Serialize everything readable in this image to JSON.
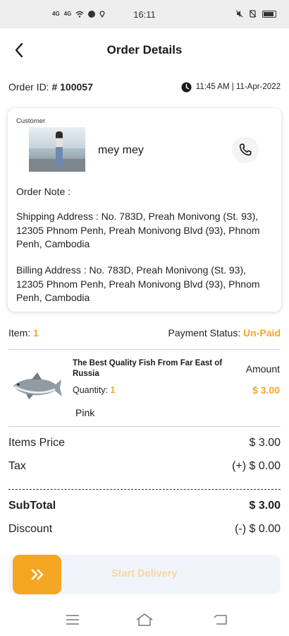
{
  "status_bar": {
    "time": "16:11",
    "signal_1": "4G",
    "signal_2": "4G"
  },
  "header": {
    "title": "Order Details",
    "back_icon": "chevron-left-icon"
  },
  "order": {
    "id_label": "Order ID: ",
    "id_value": "# 100057",
    "time": "11:45 AM | 11-Apr-2022",
    "clock_icon": "clock-icon"
  },
  "customer": {
    "label": "Customer",
    "name": "mey mey",
    "call_icon": "phone-icon",
    "order_note": "Order Note :",
    "shipping_address": "Shipping Address : No. 783D, Preah Monivong (St. 93), 12305 Phnom Penh, Preah Monivong Blvd (93), Phnom Penh, Cambodia",
    "billing_address": "Billing Address : No. 783D, Preah Monivong (St. 93), 12305 Phnom Penh, Preah Monivong Blvd (93), Phnom Penh, Cambodia"
  },
  "summary": {
    "item_label": "Item:",
    "item_count": "1",
    "payment_status_label": "Payment Status:",
    "payment_status_value": "Un-Paid"
  },
  "product": {
    "name": "The Best Quality Fish From Far East of Russia",
    "quantity_label": "Quantity:",
    "quantity_value": "1",
    "variant": "Pink",
    "amount_label": "Amount",
    "amount_value": "$ 3.00"
  },
  "totals": {
    "items_price_label": "Items Price",
    "items_price_value": "$ 3.00",
    "tax_label": "Tax",
    "tax_value": "(+) $ 0.00",
    "subtotal_label": "SubTotal",
    "subtotal_value": "$ 3.00",
    "discount_label": "Discount",
    "discount_value": "(-) $ 0.00"
  },
  "swipe": {
    "label": "Swipe to Start Delivery",
    "label_visible": "Start Delivery",
    "handle_icon": "double-chevron-right-icon"
  },
  "nav_bar": {
    "menu_icon": "menu-icon",
    "home_icon": "home-icon",
    "back_icon": "back-icon"
  },
  "colors": {
    "accent": "#f5a623",
    "swipe_track": "#f1f4fb"
  }
}
